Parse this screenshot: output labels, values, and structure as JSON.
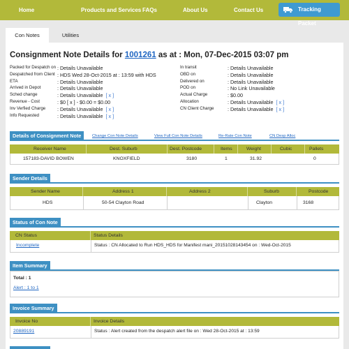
{
  "nav": {
    "items": [
      "Home",
      "Products and Services",
      "FAQs",
      "About Us",
      "Contact Us"
    ],
    "tracking_button": "Tracking Packet"
  },
  "tabs": [
    "Con Notes",
    "Utilities"
  ],
  "title": {
    "prefix": "Consignment Note Details for",
    "number": "1001261",
    "suffix": "as at : Mon, 07-Dec-2015 03:07 pm"
  },
  "details_left": [
    {
      "label": "Packed for Despatch on",
      "value": ": Details Unavailable",
      "x": ""
    },
    {
      "label": "Despatched from Client",
      "value": ": HDS Wed 28-Oct-2015 at : 13:59 with HDS",
      "x": ""
    },
    {
      "label": "ETA",
      "value": ": Details Unavailable",
      "x": ""
    },
    {
      "label": "Arrived in Depot",
      "value": ": Details Unavailable",
      "x": ""
    },
    {
      "label": "Sched change",
      "value": ": Details Unavailable",
      "x": "[ x ]"
    },
    {
      "label": "Revenue - Cost",
      "value": ": $0 [ x ] - $0.00 = $0.00",
      "x": ""
    },
    {
      "label": "Inv Verfied Charge",
      "value": ": Details Unavailable",
      "x": "[ x ]"
    },
    {
      "label": "Info Requested",
      "value": ": Details Unavailable",
      "x": "[ x ]"
    }
  ],
  "details_right": [
    {
      "label": "In transit",
      "value": ": Details Unavailable",
      "x": ""
    },
    {
      "label": "OBD on",
      "value": ": Details Unavailable",
      "x": ""
    },
    {
      "label": "Delivered on",
      "value": ": Details Unavailable",
      "x": ""
    },
    {
      "label": "POD on",
      "value": ": No Link Unavailable",
      "x": ""
    },
    {
      "label": "Actual Charge",
      "value": ": $0.00",
      "x": ""
    },
    {
      "label": "Allocation",
      "value": ": Details Unavailable",
      "x": "[ x ]"
    },
    {
      "label": "CN Client Charge",
      "value": ": Details Unavailable",
      "x": "[ x ]"
    }
  ],
  "consignment": {
    "section_title": "Details of Consignment Note",
    "links": [
      "Change Con Note Details",
      "View Full Con Note Details",
      "Re-Rate Con Note",
      "CN Desp Alloc"
    ],
    "headers": [
      "Receiver Name",
      "Dest. Suburb",
      "Dest. Postcode",
      "Items",
      "Weight",
      "Cubic",
      "Pallets"
    ],
    "row": [
      "157183-DAVID BOWEN",
      "KNOXFIELD",
      "3180",
      "1",
      "31.92",
      "",
      "0"
    ]
  },
  "sender": {
    "section_title": "Sender Details",
    "headers": [
      "Sender Name",
      "Address 1",
      "Address 2",
      "Suburb",
      "Postcode"
    ],
    "row": [
      "HDS",
      "50-54 Clayton Road",
      "",
      "Clayton",
      "3168"
    ]
  },
  "status": {
    "section_title": "Status of Con Note",
    "headers": [
      "CN Status",
      "Status Details"
    ],
    "row": [
      "Incomplete",
      "Status : CN Allocated to Run HDS_HDS for Manifest mani_20151028143454 on : Wed-Oct-2015"
    ]
  },
  "items": {
    "section_title": "Item Summary",
    "total": "Total : 1",
    "alert": "Alert : 1 to 1"
  },
  "invoice": {
    "section_title": "Invoice Summary",
    "headers": [
      "Invoice No",
      "Invoice Details"
    ],
    "row": [
      "20889191",
      "Status : Alert created from the despatch alert file on : Wed 28-Oct-2015 at : 13:59"
    ]
  },
  "colors": {
    "nav": "#b2b93a",
    "accent": "#3e90c3",
    "link": "#1f66c2"
  }
}
